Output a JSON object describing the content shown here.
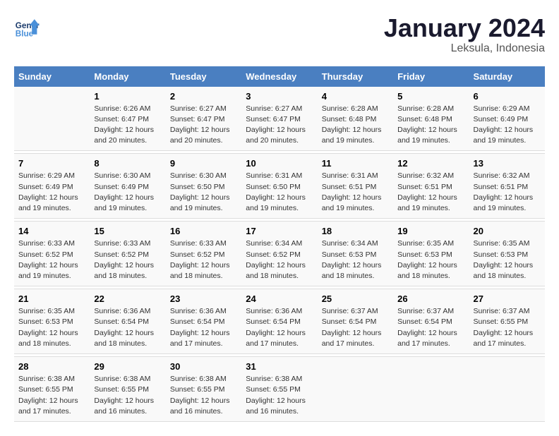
{
  "logo": {
    "line1": "General",
    "line2": "Blue"
  },
  "title": "January 2024",
  "location": "Leksula, Indonesia",
  "header_days": [
    "Sunday",
    "Monday",
    "Tuesday",
    "Wednesday",
    "Thursday",
    "Friday",
    "Saturday"
  ],
  "weeks": [
    [
      {
        "num": "",
        "info": ""
      },
      {
        "num": "1",
        "info": "Sunrise: 6:26 AM\nSunset: 6:47 PM\nDaylight: 12 hours\nand 20 minutes."
      },
      {
        "num": "2",
        "info": "Sunrise: 6:27 AM\nSunset: 6:47 PM\nDaylight: 12 hours\nand 20 minutes."
      },
      {
        "num": "3",
        "info": "Sunrise: 6:27 AM\nSunset: 6:47 PM\nDaylight: 12 hours\nand 20 minutes."
      },
      {
        "num": "4",
        "info": "Sunrise: 6:28 AM\nSunset: 6:48 PM\nDaylight: 12 hours\nand 19 minutes."
      },
      {
        "num": "5",
        "info": "Sunrise: 6:28 AM\nSunset: 6:48 PM\nDaylight: 12 hours\nand 19 minutes."
      },
      {
        "num": "6",
        "info": "Sunrise: 6:29 AM\nSunset: 6:49 PM\nDaylight: 12 hours\nand 19 minutes."
      }
    ],
    [
      {
        "num": "7",
        "info": "Sunrise: 6:29 AM\nSunset: 6:49 PM\nDaylight: 12 hours\nand 19 minutes."
      },
      {
        "num": "8",
        "info": "Sunrise: 6:30 AM\nSunset: 6:49 PM\nDaylight: 12 hours\nand 19 minutes."
      },
      {
        "num": "9",
        "info": "Sunrise: 6:30 AM\nSunset: 6:50 PM\nDaylight: 12 hours\nand 19 minutes."
      },
      {
        "num": "10",
        "info": "Sunrise: 6:31 AM\nSunset: 6:50 PM\nDaylight: 12 hours\nand 19 minutes."
      },
      {
        "num": "11",
        "info": "Sunrise: 6:31 AM\nSunset: 6:51 PM\nDaylight: 12 hours\nand 19 minutes."
      },
      {
        "num": "12",
        "info": "Sunrise: 6:32 AM\nSunset: 6:51 PM\nDaylight: 12 hours\nand 19 minutes."
      },
      {
        "num": "13",
        "info": "Sunrise: 6:32 AM\nSunset: 6:51 PM\nDaylight: 12 hours\nand 19 minutes."
      }
    ],
    [
      {
        "num": "14",
        "info": "Sunrise: 6:33 AM\nSunset: 6:52 PM\nDaylight: 12 hours\nand 19 minutes."
      },
      {
        "num": "15",
        "info": "Sunrise: 6:33 AM\nSunset: 6:52 PM\nDaylight: 12 hours\nand 18 minutes."
      },
      {
        "num": "16",
        "info": "Sunrise: 6:33 AM\nSunset: 6:52 PM\nDaylight: 12 hours\nand 18 minutes."
      },
      {
        "num": "17",
        "info": "Sunrise: 6:34 AM\nSunset: 6:52 PM\nDaylight: 12 hours\nand 18 minutes."
      },
      {
        "num": "18",
        "info": "Sunrise: 6:34 AM\nSunset: 6:53 PM\nDaylight: 12 hours\nand 18 minutes."
      },
      {
        "num": "19",
        "info": "Sunrise: 6:35 AM\nSunset: 6:53 PM\nDaylight: 12 hours\nand 18 minutes."
      },
      {
        "num": "20",
        "info": "Sunrise: 6:35 AM\nSunset: 6:53 PM\nDaylight: 12 hours\nand 18 minutes."
      }
    ],
    [
      {
        "num": "21",
        "info": "Sunrise: 6:35 AM\nSunset: 6:53 PM\nDaylight: 12 hours\nand 18 minutes."
      },
      {
        "num": "22",
        "info": "Sunrise: 6:36 AM\nSunset: 6:54 PM\nDaylight: 12 hours\nand 18 minutes."
      },
      {
        "num": "23",
        "info": "Sunrise: 6:36 AM\nSunset: 6:54 PM\nDaylight: 12 hours\nand 17 minutes."
      },
      {
        "num": "24",
        "info": "Sunrise: 6:36 AM\nSunset: 6:54 PM\nDaylight: 12 hours\nand 17 minutes."
      },
      {
        "num": "25",
        "info": "Sunrise: 6:37 AM\nSunset: 6:54 PM\nDaylight: 12 hours\nand 17 minutes."
      },
      {
        "num": "26",
        "info": "Sunrise: 6:37 AM\nSunset: 6:54 PM\nDaylight: 12 hours\nand 17 minutes."
      },
      {
        "num": "27",
        "info": "Sunrise: 6:37 AM\nSunset: 6:55 PM\nDaylight: 12 hours\nand 17 minutes."
      }
    ],
    [
      {
        "num": "28",
        "info": "Sunrise: 6:38 AM\nSunset: 6:55 PM\nDaylight: 12 hours\nand 17 minutes."
      },
      {
        "num": "29",
        "info": "Sunrise: 6:38 AM\nSunset: 6:55 PM\nDaylight: 12 hours\nand 16 minutes."
      },
      {
        "num": "30",
        "info": "Sunrise: 6:38 AM\nSunset: 6:55 PM\nDaylight: 12 hours\nand 16 minutes."
      },
      {
        "num": "31",
        "info": "Sunrise: 6:38 AM\nSunset: 6:55 PM\nDaylight: 12 hours\nand 16 minutes."
      },
      {
        "num": "",
        "info": ""
      },
      {
        "num": "",
        "info": ""
      },
      {
        "num": "",
        "info": ""
      }
    ]
  ]
}
